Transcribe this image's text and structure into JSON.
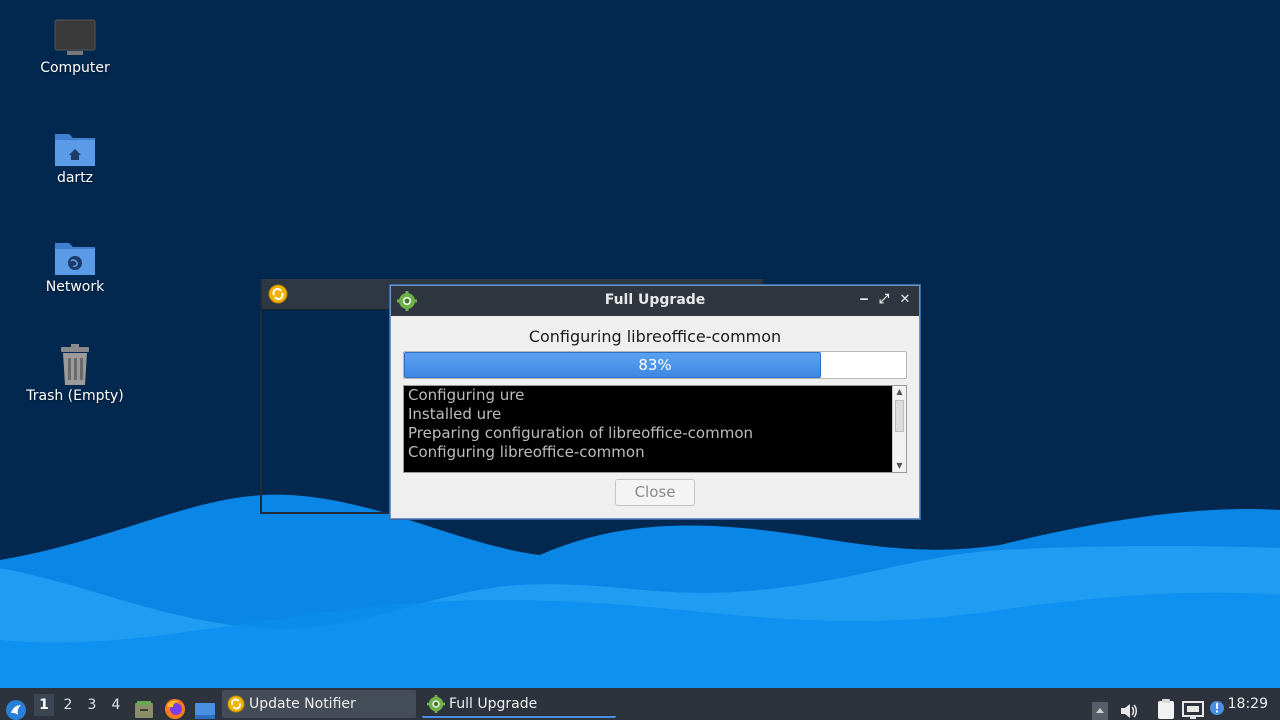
{
  "desktop": {
    "icons": [
      {
        "label": "Computer",
        "icon": "computer-icon"
      },
      {
        "label": "dartz",
        "icon": "home-folder-icon"
      },
      {
        "label": "Network",
        "icon": "network-folder-icon"
      },
      {
        "label": "Trash (Empty)",
        "icon": "trash-icon"
      }
    ]
  },
  "dialog": {
    "title": "Full Upgrade",
    "status": "Configuring libreoffice-common",
    "progress": {
      "percent": 83,
      "label": "83%"
    },
    "log_lines": [
      "Configuring ure",
      "Installed ure",
      "Preparing configuration of libreoffice-common",
      "Configuring libreoffice-common"
    ],
    "close_label": "Close",
    "controls": {
      "minimize": "‒",
      "maximize": "⤢",
      "close": "✕"
    }
  },
  "taskbar": {
    "workspaces": [
      "1",
      "2",
      "3",
      "4"
    ],
    "active_workspace": "1",
    "tasks": [
      {
        "label": "Update Notifier",
        "icon": "update-notifier-icon"
      },
      {
        "label": "Full Upgrade",
        "icon": "gear-icon"
      }
    ],
    "clock": "18:29"
  },
  "colors": {
    "accent": "#4a90e2",
    "desktop_bg": "#03284f",
    "taskbar_bg": "#2c333d"
  }
}
